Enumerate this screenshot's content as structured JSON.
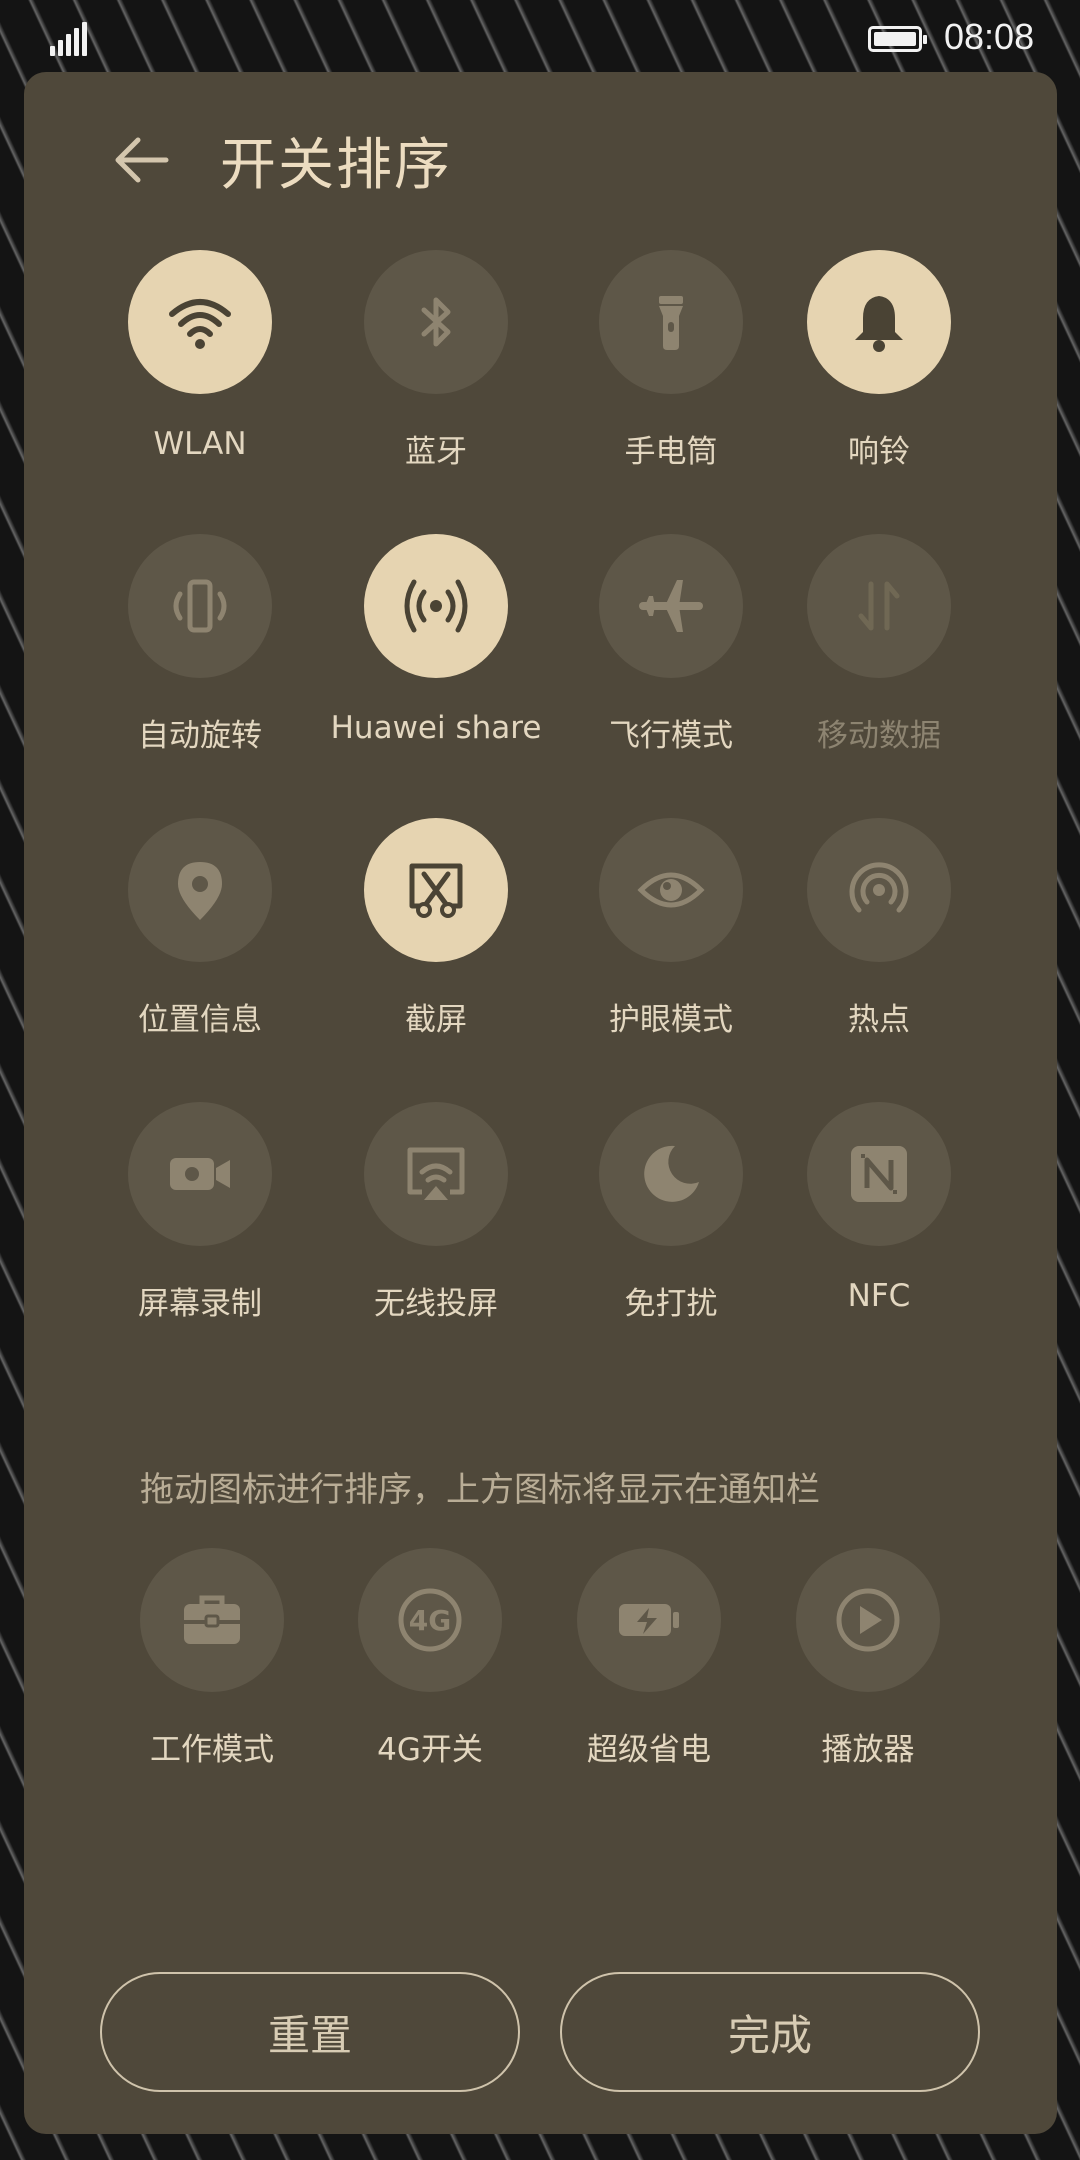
{
  "status_bar": {
    "time": "08:08"
  },
  "header": {
    "title": "开关排序"
  },
  "active_toggles": [
    {
      "label": "WLAN",
      "icon": "wifi-icon",
      "state": "on"
    },
    {
      "label": "蓝牙",
      "icon": "bluetooth-icon",
      "state": "off"
    },
    {
      "label": "手电筒",
      "icon": "flashlight-icon",
      "state": "off"
    },
    {
      "label": "响铃",
      "icon": "bell-icon",
      "state": "on"
    },
    {
      "label": "自动旋转",
      "icon": "auto-rotate-icon",
      "state": "off"
    },
    {
      "label": "Huawei share",
      "icon": "huawei-share-icon",
      "state": "on"
    },
    {
      "label": "飞行模式",
      "icon": "airplane-icon",
      "state": "off"
    },
    {
      "label": "移动数据",
      "icon": "mobile-data-icon",
      "state": "disabled"
    },
    {
      "label": "位置信息",
      "icon": "location-icon",
      "state": "off"
    },
    {
      "label": "截屏",
      "icon": "screenshot-icon",
      "state": "on"
    },
    {
      "label": "护眼模式",
      "icon": "eye-icon",
      "state": "off"
    },
    {
      "label": "热点",
      "icon": "hotspot-icon",
      "state": "off"
    },
    {
      "label": "屏幕录制",
      "icon": "screen-record-icon",
      "state": "off"
    },
    {
      "label": "无线投屏",
      "icon": "cast-icon",
      "state": "off"
    },
    {
      "label": "免打扰",
      "icon": "moon-icon",
      "state": "off"
    },
    {
      "label": "NFC",
      "icon": "nfc-icon",
      "state": "off"
    }
  ],
  "hint": "拖动图标进行排序，上方图标将显示在通知栏",
  "extra_toggles": [
    {
      "label": "工作模式",
      "icon": "briefcase-icon"
    },
    {
      "label": "4G开关",
      "icon": "4g-icon"
    },
    {
      "label": "超级省电",
      "icon": "battery-saver-icon"
    },
    {
      "label": "播放器",
      "icon": "play-icon"
    }
  ],
  "buttons": {
    "reset": "重置",
    "done": "完成"
  },
  "colors": {
    "panel": "#4f483a",
    "tile_off": "#5e5748",
    "tile_on": "#e6d4b1",
    "text": "#e3d7c0"
  }
}
